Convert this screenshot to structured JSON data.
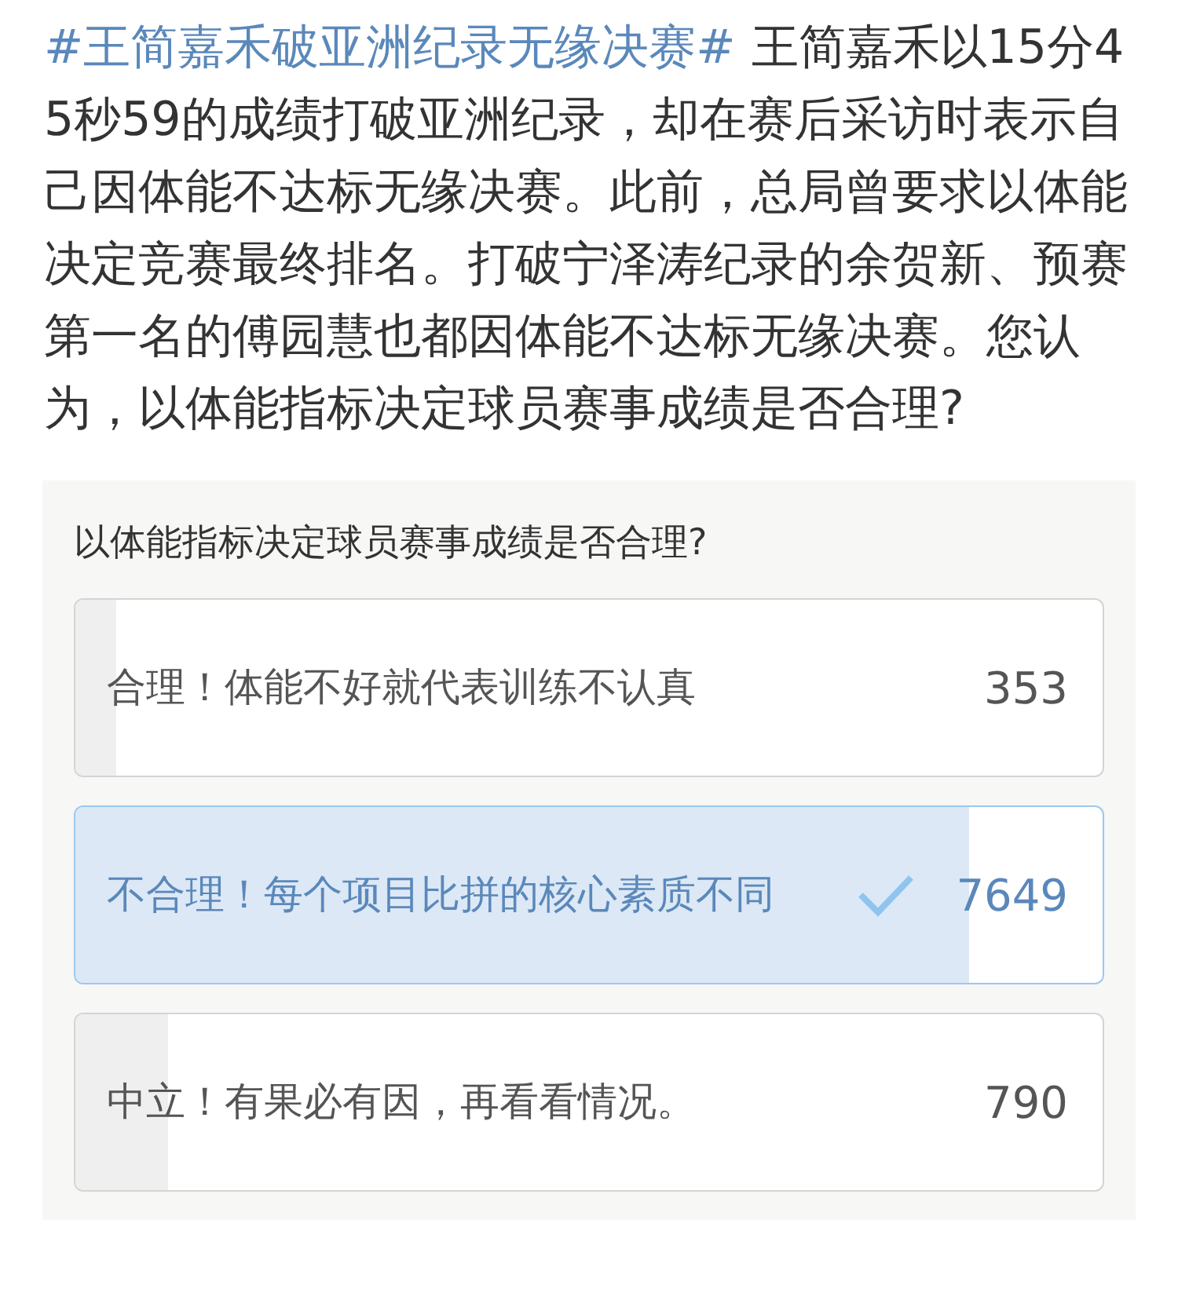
{
  "post": {
    "hashtag": "#王简嘉禾破亚洲纪录无缘决赛#",
    "text": "王简嘉禾以15分45秒59的成绩打破亚洲纪录，却在赛后采访时表示自己因体能不达标无缘决赛。此前，总局曾要求以体能决定竞赛最终排名。打破宁泽涛纪录的余贺新、预赛第一名的傅园慧也都因体能不达标无缘决赛。您认为，以体能指标决定球员赛事成绩是否合理?"
  },
  "poll": {
    "question": "以体能指标决定球员赛事成绩是否合理?",
    "options": [
      {
        "label": "合理！体能不好就代表训练不认真",
        "count": "353",
        "level": 0.04,
        "selected": false
      },
      {
        "label": "不合理！每个项目比拼的核心素质不同",
        "count": "7649",
        "level": 0.87,
        "selected": true
      },
      {
        "label": "中立！有果必有因，再看看情况。",
        "count": "790",
        "level": 0.09,
        "selected": false
      }
    ]
  }
}
